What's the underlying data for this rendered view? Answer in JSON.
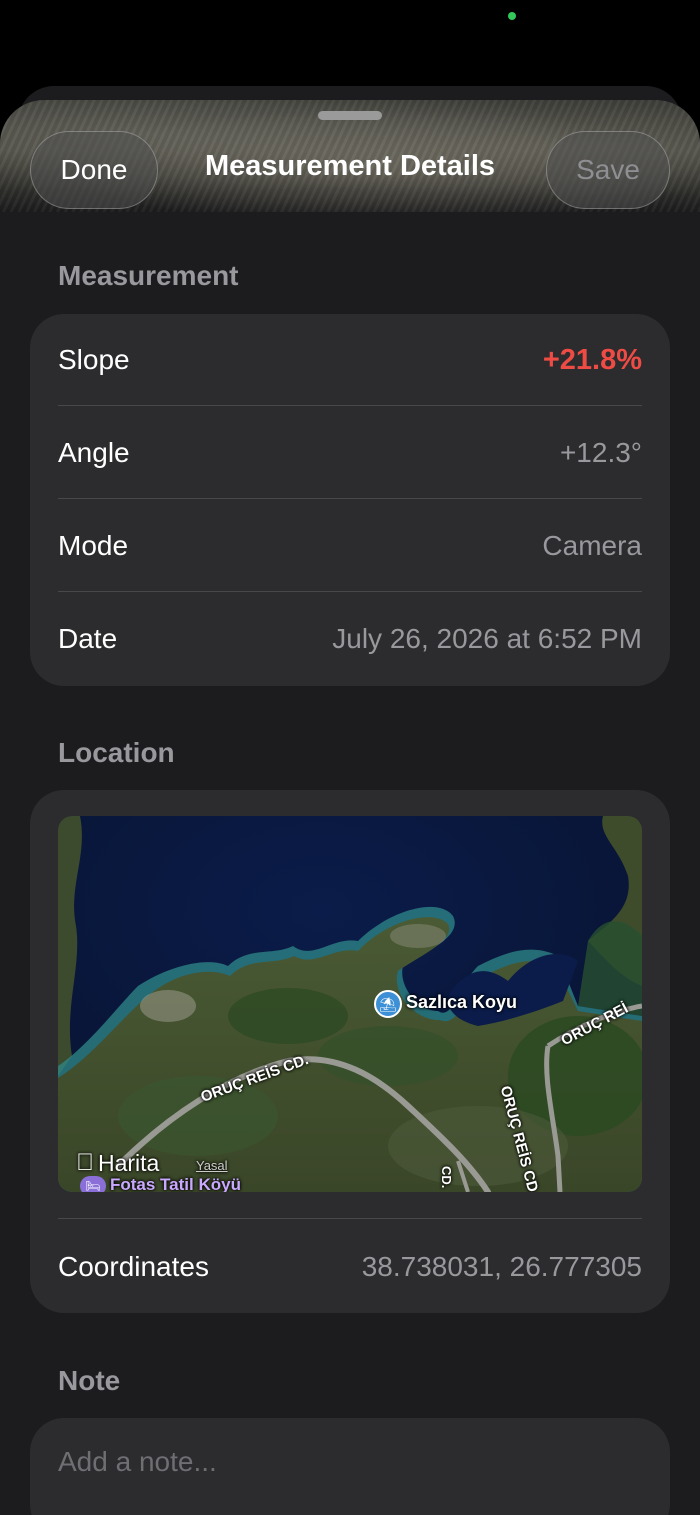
{
  "nav": {
    "done_label": "Done",
    "title": "Measurement Details",
    "save_label": "Save"
  },
  "measurement": {
    "header": "Measurement",
    "rows": [
      {
        "label": "Slope",
        "value": "+21.8%"
      },
      {
        "label": "Angle",
        "value": "+12.3°"
      },
      {
        "label": "Mode",
        "value": "Camera"
      },
      {
        "label": "Date",
        "value": "July 26, 2026 at 6:52 PM"
      }
    ]
  },
  "location": {
    "header": "Location",
    "map": {
      "poi_label": "Sazlıca Koyu",
      "road_label_1": "ORUÇ REİS CD.",
      "road_label_2": "ORUÇ REİS CD.",
      "road_label_3": "ORUÇ REİ",
      "road_label_4": "CD.",
      "brand": "Harita",
      "legal": "Yasal",
      "hotel_label": "Fotas Tatil Köyü"
    },
    "coordinates_label": "Coordinates",
    "coordinates_value": "38.738031, 26.777305"
  },
  "note": {
    "header": "Note",
    "placeholder": "Add a note..."
  },
  "colors": {
    "slope_accent": "#ef4b45",
    "status_dot": "#34c759"
  },
  "icons": [
    "beach-umbrella-icon",
    "bed-icon",
    "apple-logo-icon"
  ]
}
